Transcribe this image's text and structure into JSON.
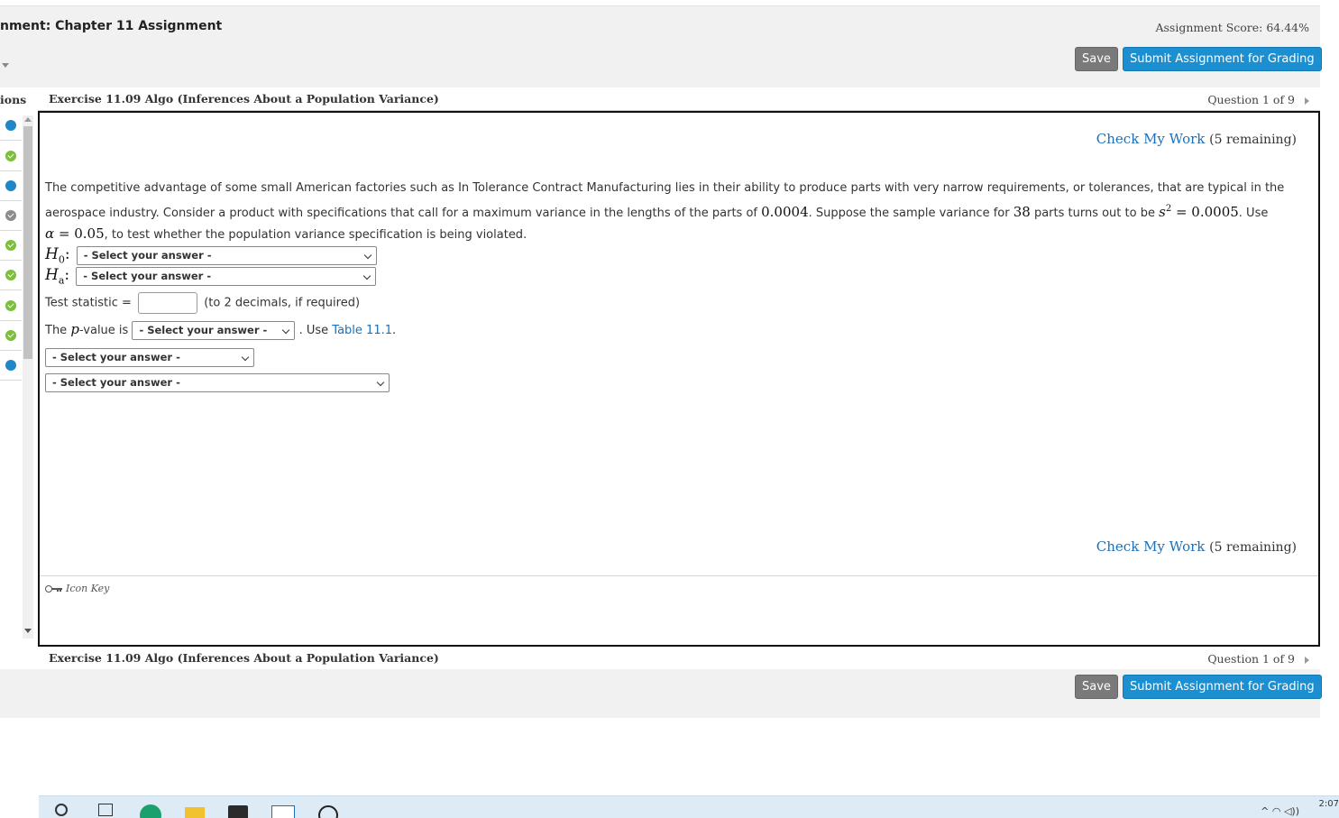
{
  "header": {
    "assignment_title": "nment: Chapter 11 Assignment",
    "score_label": "Assignment Score: 64.44%",
    "save_label": "Save",
    "submit_label": "Submit Assignment for Grading"
  },
  "sidebar": {
    "label": "ions",
    "question_states": [
      "current",
      "correct",
      "unanswered",
      "partial",
      "correct",
      "correct",
      "correct",
      "correct",
      "unanswered"
    ]
  },
  "question_bar": {
    "exercise_title": "Exercise 11.09 Algo (Inferences About a Population Variance)",
    "question_position": "Question 1 of 9"
  },
  "check_my_work": {
    "link_label": "Check My Work",
    "remaining": "(5 remaining)"
  },
  "problem": {
    "part1": "The competitive advantage of some small American factories such as In Tolerance Contract Manufacturing lies in their ability to produce parts with very narrow requirements, or tolerances, that are typical in the aerospace industry. Consider a product with specifications that call for a maximum variance in the lengths of the parts of ",
    "max_variance": "0.0004",
    "part2": ". Suppose the sample variance for ",
    "sample_size": "38",
    "part3": " parts turns out to be ",
    "s_symbol": "s",
    "s_exponent": "2",
    "equals": " = ",
    "sample_variance": "0.0005",
    "part4": ". Use",
    "alpha_symbol": "α",
    "alpha_value": "0.05",
    "part5": ", to test whether the population variance specification is being violated."
  },
  "hypotheses": {
    "h0_letter": "H",
    "h0_sub": "0",
    "ha_letter": "H",
    "ha_sub": "a",
    "colon": ":",
    "select_placeholder": "- Select your answer -"
  },
  "test_statistic": {
    "label": "Test statistic =",
    "value": "",
    "hint": "(to 2 decimals, if required)"
  },
  "pvalue": {
    "prefix": "The",
    "p_symbol": "p",
    "suffix": "-value is",
    "use_text": ". Use",
    "table_link": "Table 11.1",
    "period": "."
  },
  "conclusion_selects": {
    "select1": "- Select your answer -",
    "select2": "- Select your answer -"
  },
  "icon_key": "Icon Key",
  "bottom_bar": {
    "exercise_title": "Exercise 11.09 Algo (Inferences About a Population Variance)",
    "question_position": "Question 1 of 9",
    "save_label": "Save",
    "submit_label": "Submit Assignment for Grading"
  },
  "taskbar": {
    "clock": "2:07"
  }
}
